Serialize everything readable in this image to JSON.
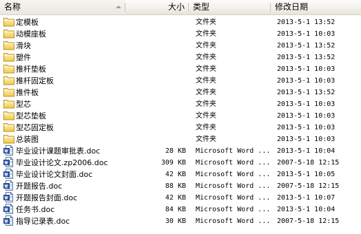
{
  "header": {
    "name": "名称",
    "size": "大小",
    "type": "类型",
    "modified": "修改日期"
  },
  "rows": [
    {
      "name": "定模板",
      "size": "",
      "type": "文件夹",
      "date": "2013-5-1 13:52",
      "icon": "folder"
    },
    {
      "name": "动模座板",
      "size": "",
      "type": "文件夹",
      "date": "2013-5-1 10:03",
      "icon": "folder"
    },
    {
      "name": "滑块",
      "size": "",
      "type": "文件夹",
      "date": "2013-5-1 13:52",
      "icon": "folder"
    },
    {
      "name": "塑件",
      "size": "",
      "type": "文件夹",
      "date": "2013-5-1 13:52",
      "icon": "folder"
    },
    {
      "name": "推杆垫板",
      "size": "",
      "type": "文件夹",
      "date": "2013-5-1 10:03",
      "icon": "folder"
    },
    {
      "name": "推杆固定板",
      "size": "",
      "type": "文件夹",
      "date": "2013-5-1 10:03",
      "icon": "folder"
    },
    {
      "name": "推件板",
      "size": "",
      "type": "文件夹",
      "date": "2013-5-1 13:52",
      "icon": "folder"
    },
    {
      "name": "型芯",
      "size": "",
      "type": "文件夹",
      "date": "2013-5-1 10:03",
      "icon": "folder"
    },
    {
      "name": "型芯垫板",
      "size": "",
      "type": "文件夹",
      "date": "2013-5-1 10:03",
      "icon": "folder"
    },
    {
      "name": "型芯固定板",
      "size": "",
      "type": "文件夹",
      "date": "2013-5-1 10:03",
      "icon": "folder"
    },
    {
      "name": "总装图",
      "size": "",
      "type": "文件夹",
      "date": "2013-5-1 10:03",
      "icon": "folder"
    },
    {
      "name": "毕业设计课题审批表.doc",
      "size": "28 KB",
      "type": "Microsoft Word ...",
      "date": "2013-5-1 10:04",
      "icon": "word-doc"
    },
    {
      "name": "毕业设计论文.zp2006.doc",
      "size": "309 KB",
      "type": "Microsoft Word ...",
      "date": "2007-5-18 12:15",
      "icon": "word-doc"
    },
    {
      "name": "毕业设计论文封面.doc",
      "size": "42 KB",
      "type": "Microsoft Word ...",
      "date": "2013-5-1 10:05",
      "icon": "word-doc"
    },
    {
      "name": "开题报告.doc",
      "size": "88 KB",
      "type": "Microsoft Word ...",
      "date": "2007-5-18 12:15",
      "icon": "word-doc"
    },
    {
      "name": "开题报告封面.doc",
      "size": "42 KB",
      "type": "Microsoft Word ...",
      "date": "2013-5-1 10:07",
      "icon": "word-doc"
    },
    {
      "name": "任务书.doc",
      "size": "84 KB",
      "type": "Microsoft Word ...",
      "date": "2013-5-1 10:04",
      "icon": "word-doc"
    },
    {
      "name": "指导记录表.doc",
      "size": "30 KB",
      "type": "Microsoft Word ...",
      "date": "2007-5-18 12:15",
      "icon": "word-doc"
    }
  ]
}
